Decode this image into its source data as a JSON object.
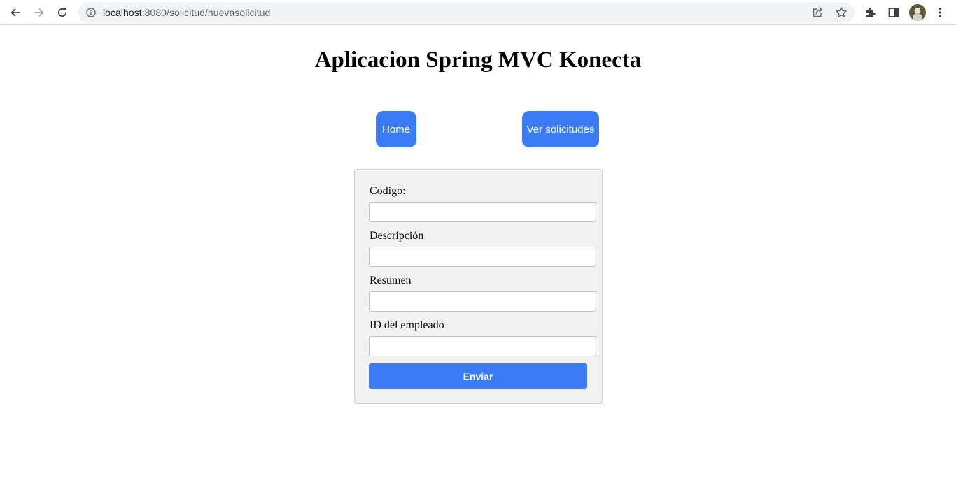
{
  "browser": {
    "url_host": "localhost",
    "url_path": ":8080/solicitud/nuevasolicitud",
    "icons": [
      "back-arrow-icon",
      "forward-arrow-icon",
      "reload-icon",
      "info-icon",
      "share-icon",
      "star-icon",
      "extensions-icon",
      "side-panel-icon",
      "avatar",
      "kebab-menu-icon"
    ]
  },
  "page": {
    "title": "Aplicacion Spring MVC Konecta",
    "nav": {
      "home_label": "Home",
      "solicitudes_label": "Ver solicitudes"
    },
    "form": {
      "fields": [
        {
          "label": "Codigo:",
          "value": "",
          "placeholder": ""
        },
        {
          "label": "Descripción",
          "value": "",
          "placeholder": ""
        },
        {
          "label": "Resumen",
          "value": "",
          "placeholder": ""
        },
        {
          "label": "ID del empleado",
          "value": "",
          "placeholder": ""
        }
      ],
      "submit_label": "Enviar"
    }
  },
  "colors": {
    "accent": "#3b7cf6",
    "form_bg": "#f2f2f2"
  }
}
